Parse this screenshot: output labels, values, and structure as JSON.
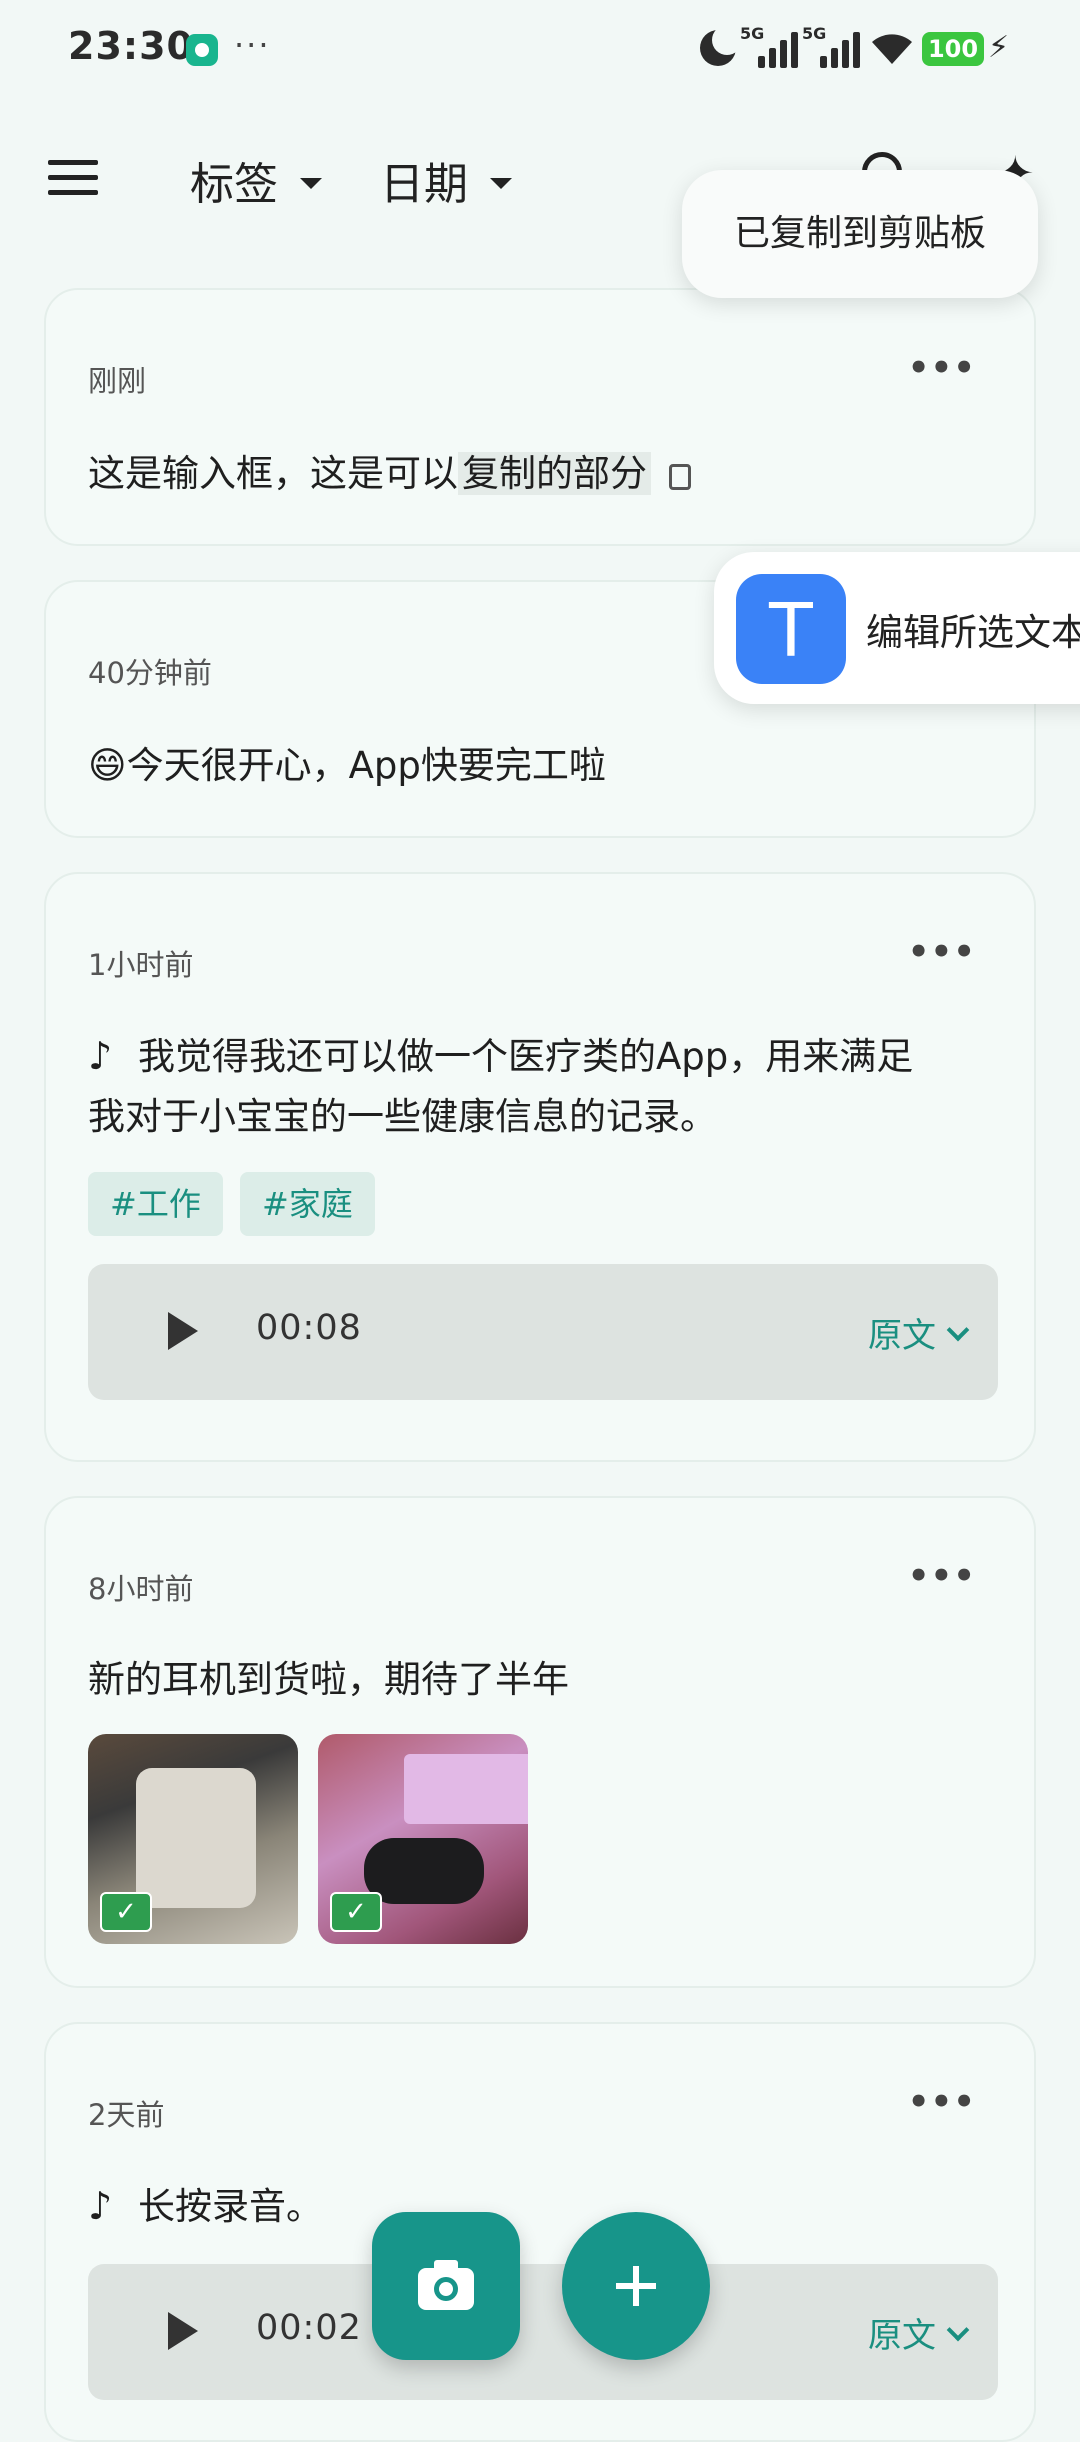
{
  "status_bar": {
    "time": "23:30",
    "more": "···",
    "signal1_label": "5G",
    "signal2_label": "5G",
    "battery": "100"
  },
  "top_bar": {
    "tag_filter": "标签",
    "date_filter": "日期"
  },
  "toast": "已复制到剪贴板",
  "edit_popup": {
    "icon_letter": "T",
    "label": "编辑所选文本"
  },
  "cards": [
    {
      "time": "刚刚",
      "text_plain": "这是输入框，这是可以",
      "text_highlight": "复制的部分"
    },
    {
      "time": "40分钟前",
      "text": "😄今天很开心，App快要完工啦"
    },
    {
      "time": "1小时前",
      "text_line1": "我觉得我还可以做一个医疗类的App，用来满足",
      "text_line2": "我对于小宝宝的一些健康信息的记录。",
      "tags": [
        "#工作",
        "#家庭"
      ],
      "audio_duration": "00:08",
      "audio_original": "原文"
    },
    {
      "time": "8小时前",
      "text": "新的耳机到货啦，期待了半年",
      "images": [
        "earbud-case-white",
        "earbud-case-black-sony"
      ]
    },
    {
      "time": "2天前",
      "text": "长按录音。",
      "audio_duration": "00:02",
      "audio_original": "原文"
    }
  ],
  "icons": {
    "menu": "hamburger-icon",
    "search": "search-icon",
    "sparkle": "sparkle-icon",
    "camera": "camera-icon",
    "add": "plus-icon",
    "note": "music-note-icon"
  },
  "colors": {
    "accent": "#17958A",
    "background": "#F2F8F6",
    "tag_bg": "#DCEDE8",
    "app_icon_blue": "#3A82F7"
  }
}
